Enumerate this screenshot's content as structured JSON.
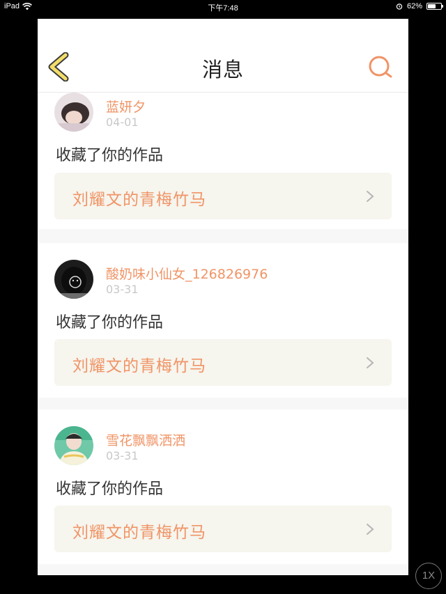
{
  "status_bar": {
    "device": "iPad",
    "time": "下午7:48",
    "battery": "62%",
    "battery_level": 0.62
  },
  "navbar": {
    "title": "消息",
    "back_icon": "chevron-left-icon",
    "search_icon": "search-icon"
  },
  "messages": [
    {
      "username": "蓝妍夕",
      "date": "04-01",
      "action": "收藏了你的作品",
      "work_title": "刘耀文的青梅竹马"
    },
    {
      "username": "酸奶味小仙女_126826976",
      "date": "03-31",
      "action": "收藏了你的作品",
      "work_title": "刘耀文的青梅竹马"
    },
    {
      "username": "雪花飘飘洒洒",
      "date": "03-31",
      "action": "收藏了你的作品",
      "work_title": "刘耀文的青梅竹马"
    }
  ],
  "zoom_button": "1X",
  "colors": {
    "accent": "#f09466",
    "back_icon": "#f3dd6a",
    "card_bg": "#f6f5ee",
    "date": "#c8c8c8"
  }
}
